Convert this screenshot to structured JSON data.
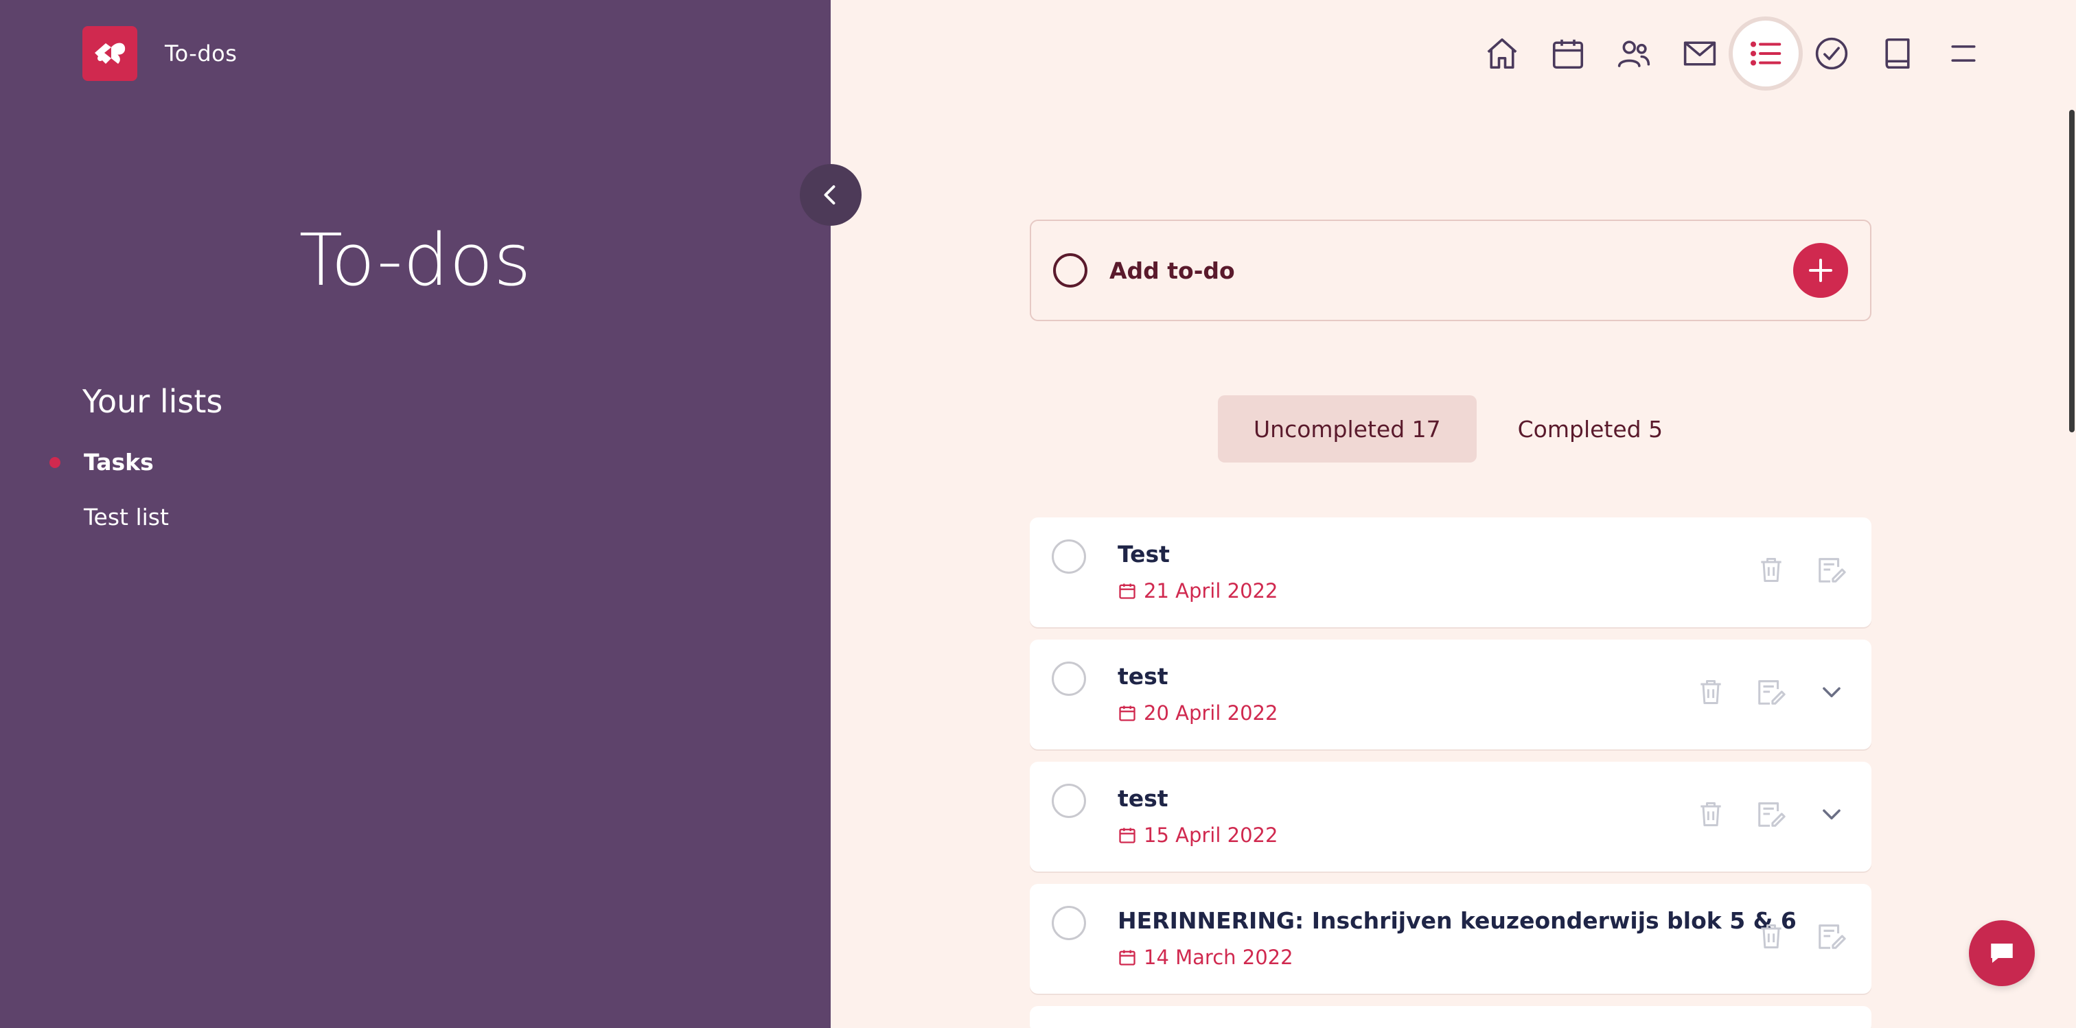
{
  "app": {
    "name": "To-dos"
  },
  "sidebar": {
    "title": "To-dos",
    "lists_heading": "Your lists",
    "lists": [
      {
        "label": "Tasks",
        "active": true
      },
      {
        "label": "Test list",
        "active": false
      }
    ]
  },
  "nav": {
    "items": [
      {
        "icon": "home-icon"
      },
      {
        "icon": "calendar-icon"
      },
      {
        "icon": "people-icon"
      },
      {
        "icon": "mail-icon"
      },
      {
        "icon": "list-icon",
        "active": true
      },
      {
        "icon": "check-circle-icon"
      },
      {
        "icon": "book-icon"
      },
      {
        "icon": "menu-icon"
      }
    ]
  },
  "add_todo": {
    "label": "Add to-do"
  },
  "tabs": {
    "uncompleted": "Uncompleted 17",
    "completed": "Completed 5"
  },
  "todos": [
    {
      "title": "Test",
      "date": "21 April 2022",
      "expandable": false
    },
    {
      "title": "test",
      "date": "20 April 2022",
      "expandable": true
    },
    {
      "title": "test",
      "date": "15 April 2022",
      "expandable": true
    },
    {
      "title": "HERINNERING: Inschrijven keuzeonderwijs blok 5 & 6",
      "date": "14 March 2022",
      "expandable": false
    }
  ],
  "colors": {
    "sidebar": "#5e436b",
    "accent": "#d0294f",
    "background": "#fdf1ec",
    "text_dark": "#1f2547",
    "maroon": "#5a1a2c"
  }
}
